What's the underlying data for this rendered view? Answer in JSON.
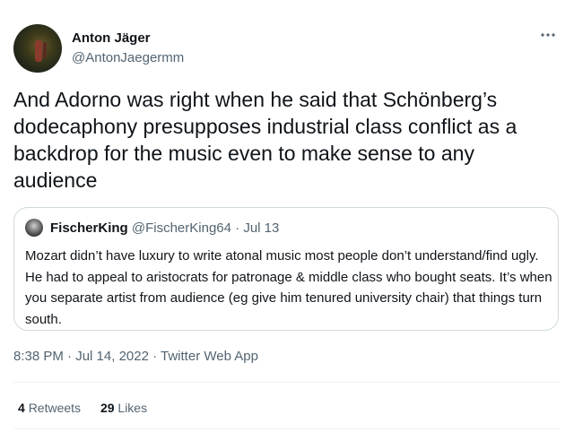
{
  "author": {
    "display_name": "Anton Jäger",
    "handle": "@AntonJaegermm"
  },
  "tweet": {
    "text": "And Adorno was right when he said that Schönberg’s dodecaphony presupposes industrial class conflict as a backdrop for the music even to make sense to any audience"
  },
  "quoted_tweet": {
    "display_name": "FischerKing",
    "handle": "@FischerKing64",
    "separator": " · ",
    "date": "Jul 13",
    "text": "Mozart didn’t have luxury to write atonal music most people don’t understand/find ugly. He had to appeal to aristocrats for patronage & middle class who bought seats. It’s when you separate artist from audience (eg give him tenured university chair) that things turn south."
  },
  "meta": {
    "time": "8:38 PM",
    "sep": " · ",
    "date": "Jul 14, 2022",
    "source": "Twitter Web App"
  },
  "stats": {
    "retweets_count": "4",
    "retweets_label": "Retweets",
    "likes_count": "29",
    "likes_label": "Likes"
  },
  "icons": {
    "more": "more-horizontal-icon"
  },
  "colors": {
    "text_primary": "#0f1419",
    "text_secondary": "#536471",
    "border": "#cfd9de",
    "divider": "#eff3f4"
  }
}
